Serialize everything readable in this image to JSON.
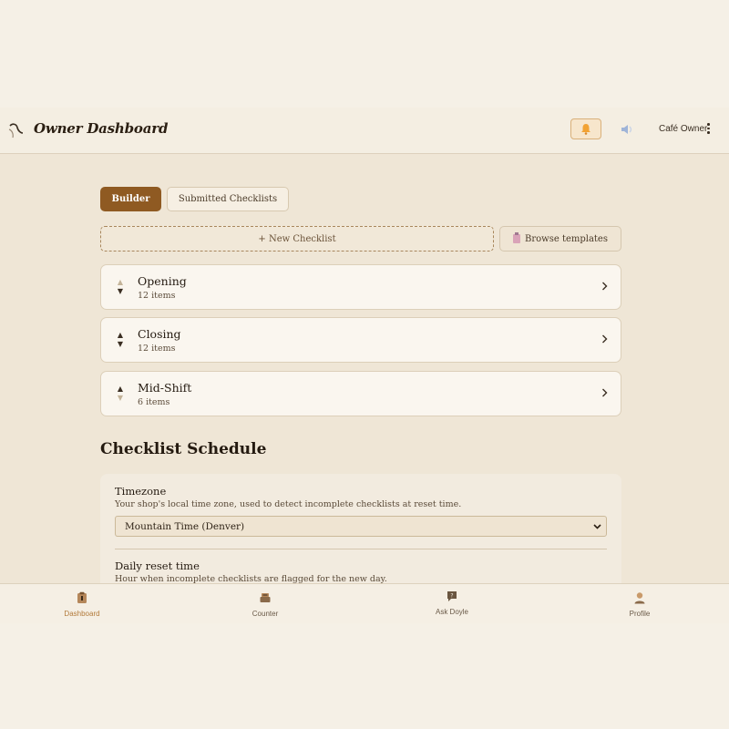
{
  "header": {
    "title": "Owner Dashboard",
    "user_label": "Café Owner",
    "icons": [
      "logo-icon",
      "bell-icon",
      "speaker-icon",
      "more-vertical-icon"
    ]
  },
  "tabs": [
    {
      "label": "Builder",
      "active": true
    },
    {
      "label": "Submitted Checklists",
      "active": false
    }
  ],
  "actions": {
    "new_checklist": "+ New Checklist",
    "browse_templates": "Browse templates"
  },
  "checklists": [
    {
      "name": "Opening",
      "count": "12 items"
    },
    {
      "name": "Closing",
      "count": "12 items"
    },
    {
      "name": "Mid-Shift",
      "count": "6 items"
    }
  ],
  "schedule": {
    "title": "Checklist Schedule",
    "timezone_label": "Timezone",
    "timezone_help": "Your shop's local time zone, used to detect incomplete checklists at reset time.",
    "timezone_value": "Mountain Time (Denver)",
    "reset_label": "Daily reset time",
    "reset_help": "Hour when incomplete checklists are flagged for the new day."
  },
  "bottom_nav": [
    {
      "label": "Dashboard",
      "icon": "dashboard-icon",
      "active": true
    },
    {
      "label": "Counter",
      "icon": "register-icon",
      "active": false
    },
    {
      "label": "Ask Doyle",
      "icon": "chat-icon",
      "active": false
    },
    {
      "label": "Profile",
      "icon": "profile-icon",
      "active": false
    }
  ],
  "colors": {
    "accent": "#8f5a22",
    "nav_active": "#b27a3a",
    "background": "#efe6d6"
  }
}
